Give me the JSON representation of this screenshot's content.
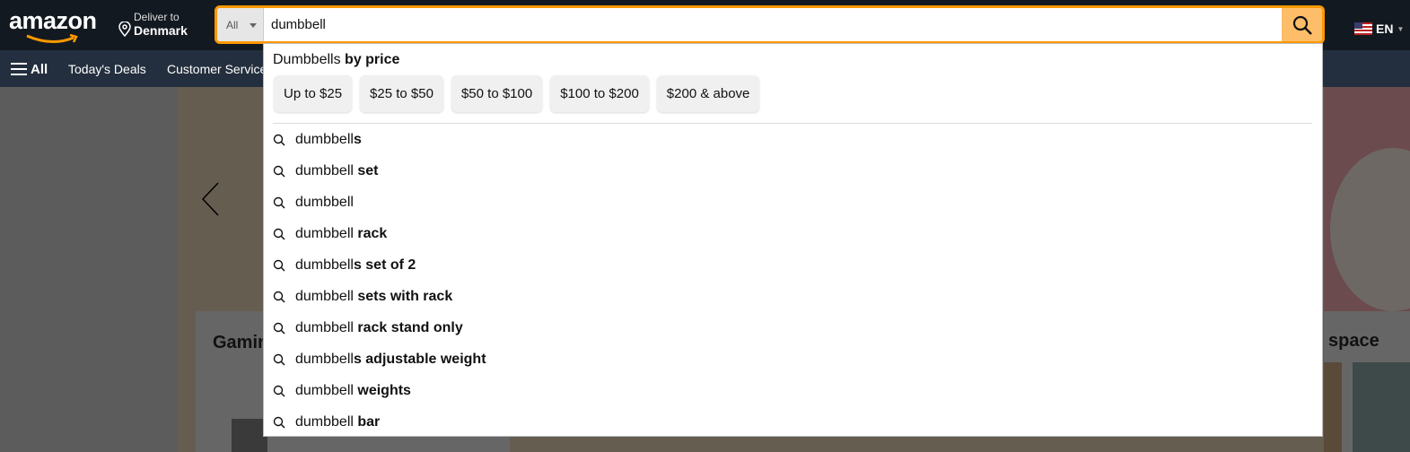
{
  "header": {
    "logo": "amazon",
    "deliver_label": "Deliver to",
    "deliver_location": "Denmark",
    "language": "EN"
  },
  "search": {
    "category": "All",
    "query": "dumbbell"
  },
  "nav": {
    "all": "All",
    "items": [
      "Today's Deals",
      "Customer Service"
    ]
  },
  "dropdown": {
    "title_regular": "Dumbbells",
    "title_bold": " by price",
    "price_chips": [
      "Up to $25",
      "$25 to $50",
      "$50 to $100",
      "$100 to $200",
      "$200 & above"
    ],
    "suggestions": [
      {
        "prefix": "dumbbell",
        "bold": "s"
      },
      {
        "prefix": "dumbbell",
        "bold": " set"
      },
      {
        "prefix": "dumbbell",
        "bold": ""
      },
      {
        "prefix": "dumbbell",
        "bold": " rack"
      },
      {
        "prefix": "dumbbell",
        "bold": "s set of 2"
      },
      {
        "prefix": "dumbbell",
        "bold": " sets with rack"
      },
      {
        "prefix": "dumbbell",
        "bold": " rack stand only"
      },
      {
        "prefix": "dumbbell",
        "bold": "s adjustable weight"
      },
      {
        "prefix": "dumbbell",
        "bold": " weights"
      },
      {
        "prefix": "dumbbell",
        "bold": " bar"
      }
    ]
  },
  "cards": {
    "left_title": "Gamin",
    "right_title": "space"
  },
  "colors": {
    "header": "#131921",
    "nav": "#232f3e",
    "search_border": "#ff9900",
    "search_button": "#febd69"
  }
}
